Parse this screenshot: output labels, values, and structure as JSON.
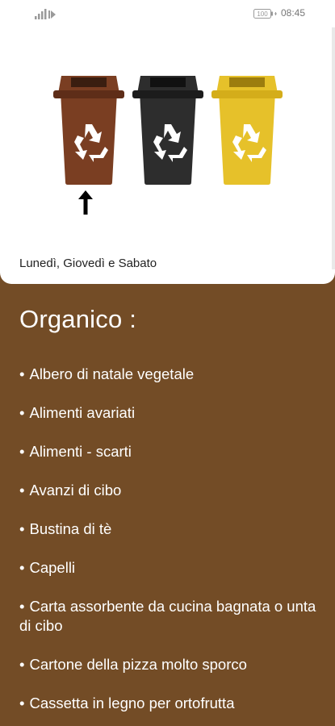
{
  "status_bar": {
    "time": "08:45",
    "battery_label": "100",
    "signal_icon": "signal-icon",
    "battery_icon": "battery-icon"
  },
  "bins": [
    {
      "name": "organic-bin",
      "color": "#7a3e22",
      "lid": "#5e2d18",
      "icon": "recycle-icon"
    },
    {
      "name": "general-bin",
      "color": "#2d2d2d",
      "lid": "#1c1c1c",
      "icon": "recycle-icon"
    },
    {
      "name": "plastic-bin",
      "color": "#e6c12a",
      "lid": "#d4ad1a",
      "icon": "recycle-icon"
    }
  ],
  "selected_bin_indicator_icon": "arrow-up-icon",
  "schedule": "Lunedì, Giovedì e Sabato",
  "category": {
    "title": "Organico :",
    "background": "#734c26",
    "items": [
      "Albero di natale vegetale",
      "Alimenti avariati",
      "Alimenti - scarti",
      "Avanzi di cibo",
      "Bustina di tè",
      "Capelli",
      "Carta assorbente da cucina bagnata o unta di cibo",
      "Cartone della pizza molto sporco",
      "Cassetta in legno per ortofrutta"
    ]
  }
}
